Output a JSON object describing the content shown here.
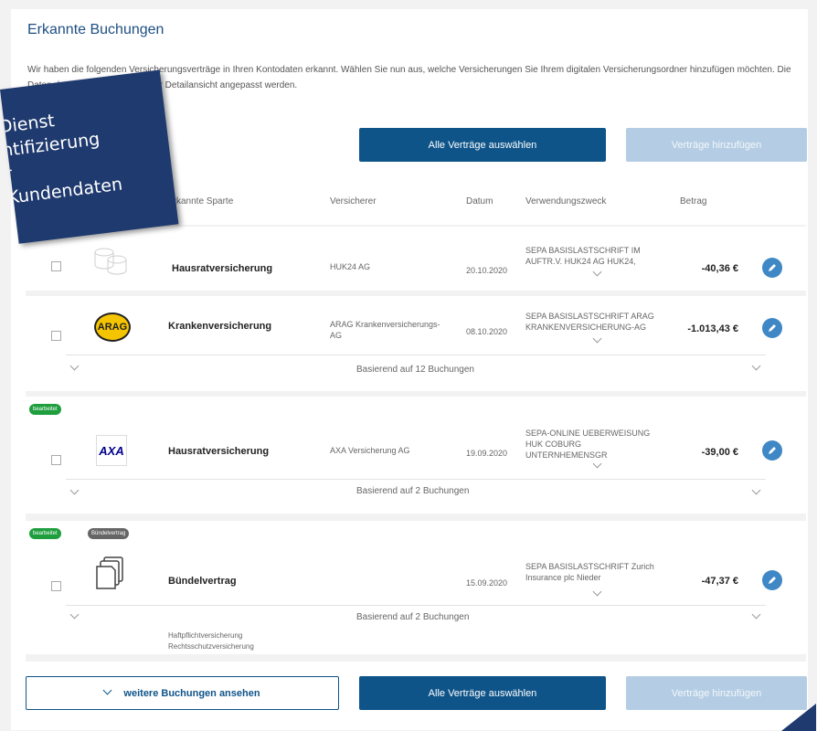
{
  "header": {
    "title": "Erkannte Buchungen",
    "intro": "Wir haben die folgenden Versicherungsverträge in Ihren Kontodaten erkannt. Wählen Sie nun aus, welche Versicherungen Sie Ihrem digitalen Versicherungsordner hinzufügen möchten. Die Daten der Verträge können in der Detailansicht angepasst werden."
  },
  "actions": {
    "select_all": "Alle Verträge auswählen",
    "add_contracts": "Verträge hinzufügen",
    "more_bookings": "weitere Buchungen ansehen"
  },
  "table": {
    "columns": [
      "Erkannte Sparte",
      "Versicherer",
      "Datum",
      "Verwendungszweck",
      "Betrag"
    ]
  },
  "rows": [
    {
      "sparte": "Hausratversicherung",
      "insurer": "HUK24 AG",
      "date": "20.10.2020",
      "purpose": "SEPA BASISLASTSCHRIFT IM AUFTR.V. HUK24 AG HUK24,",
      "amount": "-40,36 €",
      "icon": "stack-icon"
    },
    {
      "sparte": "Krankenversicherung",
      "insurer": "ARAG Krankenversicherungs-AG",
      "date": "08.10.2020",
      "purpose": "SEPA BASISLASTSCHRIFT ARAG KRANKENVERSICHERUNG-AG",
      "amount": "-1.013,43 €",
      "basis": "Basierend auf 12 Buchungen",
      "logo_text": "ARAG"
    },
    {
      "sparte": "Hausratversicherung",
      "insurer": "AXA Versicherung AG",
      "date": "19.09.2020",
      "purpose": "SEPA-ONLINE UEBERWEISUNG HUK COBURG UNTERNHEMENSGR",
      "amount": "-39,00 €",
      "basis": "Basierend auf 2 Buchungen",
      "badge": "bearbeitet",
      "logo_text": "AXA"
    },
    {
      "sparte": "Bündelvertrag",
      "date": "15.09.2020",
      "purpose": "SEPA BASISLASTSCHRIFT Zurich Insurance plc Nieder",
      "amount": "-47,37 €",
      "basis": "Basierend auf 2 Buchungen",
      "badge": "bearbeitet",
      "badge2": "Bündelvertrag",
      "sub1": "Haftpflichtversicherung",
      "sub2": "Rechtsschutzversicherung",
      "icon": "documents-icon"
    }
  ],
  "overlay": {
    "line1": "Dienst",
    "line2": "ntifizierung",
    "line3": "r",
    "line4": "Kundendaten"
  },
  "colors": {
    "accent": "#0f5489",
    "disabled": "#b4cde4",
    "badge_green": "#1f9e3e",
    "badge_gray": "#666666",
    "overlay": "#1f3a6e"
  }
}
